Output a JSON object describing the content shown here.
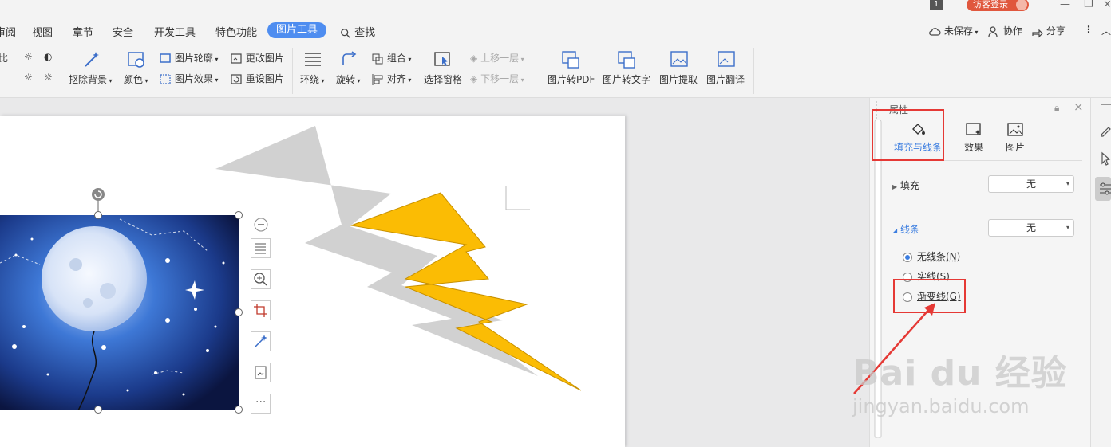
{
  "titlebar": {
    "page_number": "1",
    "visitor_login": "访客登录"
  },
  "tabs": [
    {
      "label": "审阅"
    },
    {
      "label": "视图"
    },
    {
      "label": "章节"
    },
    {
      "label": "安全"
    },
    {
      "label": "开发工具"
    },
    {
      "label": "特色功能"
    },
    {
      "label": "图片工具"
    },
    {
      "label": "查找"
    }
  ],
  "tabbar_right": {
    "unsaved": "未保存",
    "collab": "协作",
    "share": "分享"
  },
  "ribbon": {
    "remove_bg": "抠除背景",
    "color": "颜色",
    "outline": "图片轮廓",
    "effect": "图片效果",
    "change_pic": "更改图片",
    "reset_pic": "重设图片",
    "wrap": "环绕",
    "rotate": "旋转",
    "group": "组合",
    "align": "对齐",
    "selection_pane": "选择窗格",
    "move_up": "上移一层",
    "move_down": "下移一层",
    "to_pdf": "图片转PDF",
    "to_text": "图片转文字",
    "extract": "图片提取",
    "translate": "图片翻译"
  },
  "panel": {
    "title": "属性",
    "tabs": [
      {
        "label": "填充与线条"
      },
      {
        "label": "效果"
      },
      {
        "label": "图片"
      }
    ],
    "fill": {
      "label": "填充",
      "value": "无"
    },
    "line": {
      "label": "线条",
      "value": "无"
    },
    "line_options": [
      {
        "label": "无线条(N)",
        "selected": true
      },
      {
        "label": "实线(S)",
        "selected": false
      },
      {
        "label": "渐变线(G)",
        "selected": false
      }
    ]
  },
  "watermark": {
    "brand": "Bai du 经验",
    "url": "jingyan.baidu.com"
  },
  "colors": {
    "accent": "#4e8df0",
    "bolt": "#fbbc04",
    "highlight": "#e53935"
  }
}
